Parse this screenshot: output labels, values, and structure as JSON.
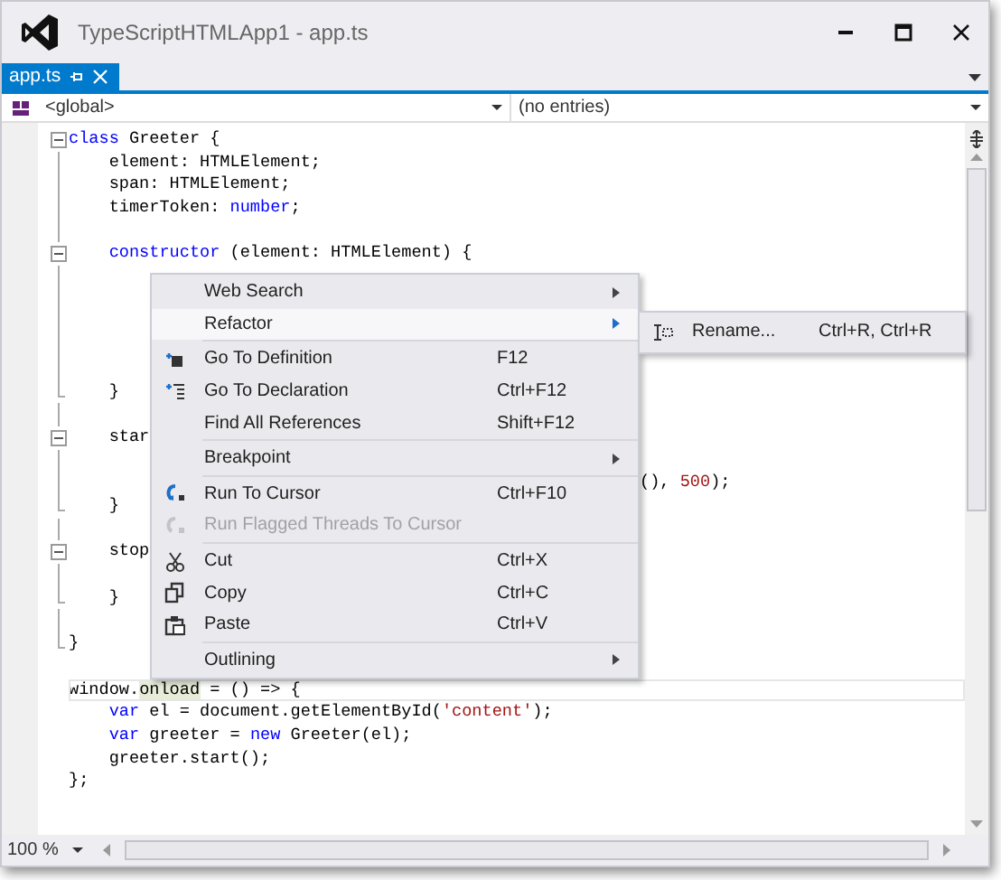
{
  "window": {
    "title": "TypeScriptHTMLApp1 - app.ts"
  },
  "tabs": [
    {
      "label": "app.ts",
      "selected": true
    }
  ],
  "nav_bar": {
    "scope": "<global>",
    "members": "(no entries)"
  },
  "code_lines": [
    {
      "kind": "fold-start",
      "segments": [
        {
          "kind": "kw",
          "text": "class"
        },
        {
          "kind": "plain",
          "text": " Greeter {"
        }
      ]
    },
    {
      "kind": "fold-body",
      "segments": [
        {
          "kind": "plain",
          "text": "    element: HTMLElement;"
        }
      ]
    },
    {
      "kind": "fold-body",
      "segments": [
        {
          "kind": "plain",
          "text": "    span: HTMLElement;"
        }
      ]
    },
    {
      "kind": "fold-body",
      "segments": [
        {
          "kind": "plain",
          "text": "    timerToken: "
        },
        {
          "kind": "kw",
          "text": "number"
        },
        {
          "kind": "plain",
          "text": ";"
        }
      ]
    },
    {
      "kind": "fold-body"
    },
    {
      "kind": "fold-start",
      "segments": [
        {
          "kind": "kw",
          "text": "    constructor"
        },
        {
          "kind": "plain",
          "text": " (element: HTMLElement) {"
        }
      ]
    },
    {
      "kind": "fold-body"
    },
    {
      "kind": "fold-body"
    },
    {
      "kind": "fold-body"
    },
    {
      "kind": "fold-body"
    },
    {
      "kind": "fold-body"
    },
    {
      "kind": "fold-end",
      "segments": [
        {
          "kind": "plain",
          "text": "    }"
        }
      ]
    },
    {
      "kind": "fold-body"
    },
    {
      "kind": "fold-start",
      "segments": [
        {
          "kind": "plain",
          "text": "    star"
        }
      ]
    },
    {
      "kind": "fold-body"
    },
    {
      "kind": "fold-body",
      "segments": [
        {
          "kind": "after-menu",
          "text": "(), "
        },
        {
          "kind": "num",
          "text": "500"
        },
        {
          "kind": "plain",
          "text": ");"
        }
      ]
    },
    {
      "kind": "fold-end",
      "segments": [
        {
          "kind": "plain",
          "text": "    }"
        }
      ]
    },
    {
      "kind": "fold-body"
    },
    {
      "kind": "fold-start",
      "segments": [
        {
          "kind": "plain",
          "text": "    stop"
        }
      ]
    },
    {
      "kind": "fold-body"
    },
    {
      "kind": "fold-end",
      "segments": [
        {
          "kind": "plain",
          "text": "    }"
        }
      ]
    },
    {
      "kind": "fold-body"
    },
    {
      "kind": "fold-end",
      "segments": [
        {
          "kind": "plain",
          "text": "}"
        }
      ]
    },
    {
      "kind": "plain"
    },
    {
      "kind": "plain",
      "current": true,
      "segments": [
        {
          "kind": "plain",
          "text": "window."
        },
        {
          "kind": "hl",
          "text": "onload"
        },
        {
          "kind": "plain",
          "text": " = () => {"
        }
      ]
    },
    {
      "kind": "plain",
      "segments": [
        {
          "kind": "kw",
          "text": "    var"
        },
        {
          "kind": "plain",
          "text": " el = document.getElementById("
        },
        {
          "kind": "str",
          "text": "'content'"
        },
        {
          "kind": "plain",
          "text": ");"
        }
      ]
    },
    {
      "kind": "plain",
      "segments": [
        {
          "kind": "kw",
          "text": "    var"
        },
        {
          "kind": "plain",
          "text": " greeter = "
        },
        {
          "kind": "kw",
          "text": "new"
        },
        {
          "kind": "plain",
          "text": " Greeter(el);"
        }
      ]
    },
    {
      "kind": "plain",
      "segments": [
        {
          "kind": "plain",
          "text": "    greeter.start();"
        }
      ]
    },
    {
      "kind": "plain",
      "segments": [
        {
          "kind": "plain",
          "text": "};"
        }
      ]
    }
  ],
  "context_menu": {
    "items": [
      {
        "kind": "item",
        "label": "Web Search",
        "submenu": true,
        "selected": false,
        "disabled": false
      },
      {
        "kind": "item",
        "label": "Refactor",
        "submenu": true,
        "selected": true,
        "disabled": false
      },
      {
        "kind": "separator"
      },
      {
        "kind": "item",
        "label": "Go To Definition",
        "shortcut": "F12",
        "submenu": false,
        "selected": false,
        "disabled": false
      },
      {
        "kind": "item",
        "label": "Go To Declaration",
        "shortcut": "Ctrl+F12",
        "submenu": false,
        "selected": false,
        "disabled": false
      },
      {
        "kind": "item",
        "label": "Find All References",
        "shortcut": "Shift+F12",
        "submenu": false,
        "selected": false,
        "disabled": false
      },
      {
        "kind": "separator"
      },
      {
        "kind": "item",
        "label": "Breakpoint",
        "submenu": true,
        "selected": false,
        "disabled": false
      },
      {
        "kind": "separator"
      },
      {
        "kind": "item",
        "label": "Run To Cursor",
        "shortcut": "Ctrl+F10",
        "submenu": false,
        "selected": false,
        "disabled": false
      },
      {
        "kind": "item",
        "label": "Run Flagged Threads To Cursor",
        "submenu": false,
        "selected": false,
        "disabled": true
      },
      {
        "kind": "separator"
      },
      {
        "kind": "item",
        "label": "Cut",
        "shortcut": "Ctrl+X",
        "submenu": false,
        "selected": false,
        "disabled": false
      },
      {
        "kind": "item",
        "label": "Copy",
        "shortcut": "Ctrl+C",
        "submenu": false,
        "selected": false,
        "disabled": false
      },
      {
        "kind": "item",
        "label": "Paste",
        "shortcut": "Ctrl+V",
        "submenu": false,
        "selected": false,
        "disabled": false
      },
      {
        "kind": "separator"
      },
      {
        "kind": "item",
        "label": "Outlining",
        "submenu": true,
        "selected": false,
        "disabled": false
      }
    ]
  },
  "submenu": {
    "items": [
      {
        "label": "Rename...",
        "shortcut": "Ctrl+R, Ctrl+R"
      }
    ]
  },
  "status": {
    "zoom": "100 %"
  }
}
